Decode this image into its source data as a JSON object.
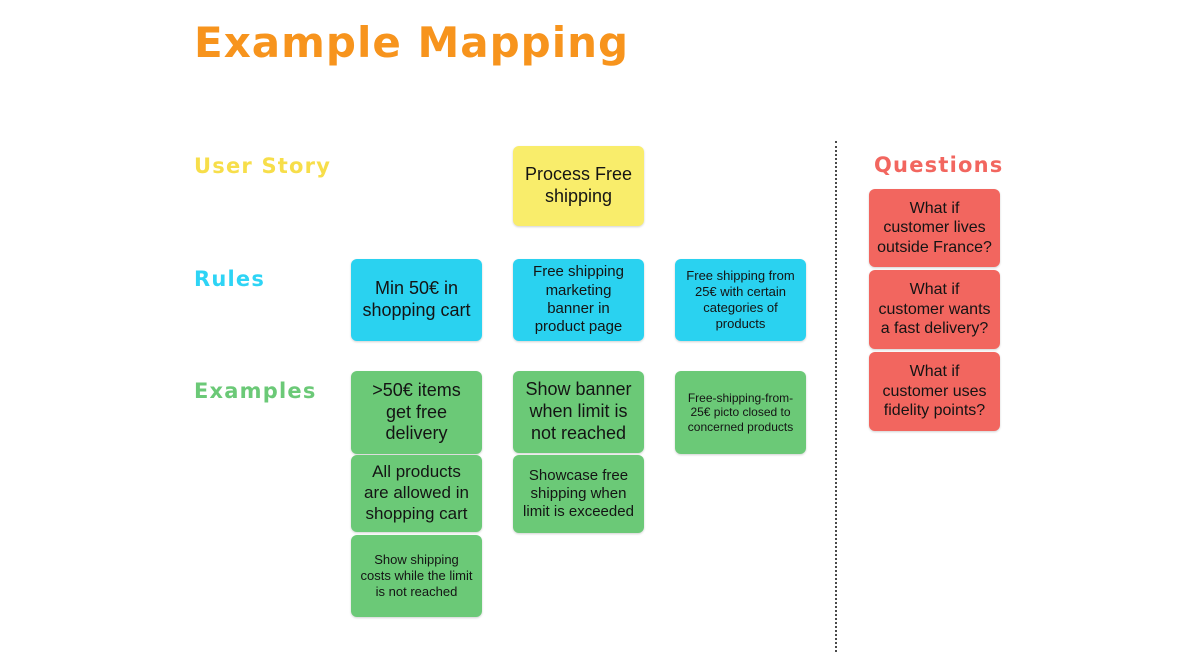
{
  "board": {
    "title": "Example Mapping",
    "divider_name": "vertical-dotted-divider"
  },
  "colors": {
    "title": "#F7941D",
    "user_story": "#F7DE4A",
    "rules": "#2ED4F5",
    "examples": "#6BC977",
    "questions": "#F2665F",
    "card_yellow": "#F9ED6B",
    "card_cyan": "#2AD2F0",
    "card_green": "#6BC977",
    "card_red": "#F2665F",
    "background": "#FFFFFF"
  },
  "rows": {
    "user_story": {
      "label": "User Story"
    },
    "rules": {
      "label": "Rules"
    },
    "examples": {
      "label": "Examples"
    }
  },
  "questions_section": {
    "label": "Questions"
  },
  "user_story_cards": [
    {
      "text": "Process Free shipping",
      "color": "yellow"
    }
  ],
  "rule_cards": [
    {
      "text": "Min 50€ in shopping cart",
      "color": "cyan"
    },
    {
      "text": "Free shipping marketing banner in product page",
      "color": "cyan"
    },
    {
      "text": "Free shipping from 25€ with certain categories of products",
      "color": "cyan"
    }
  ],
  "example_cards": {
    "column_1": [
      {
        "text": ">50€ items get free delivery",
        "color": "green"
      },
      {
        "text": "All products are allowed in shopping cart",
        "color": "green"
      },
      {
        "text": "Show shipping costs while the limit is not reached",
        "color": "green"
      }
    ],
    "column_2": [
      {
        "text": "Show banner when limit is not reached",
        "color": "green"
      },
      {
        "text": "Showcase free shipping when limit is exceeded",
        "color": "green"
      }
    ],
    "column_3": [
      {
        "text": "Free-shipping-from-25€ picto closed to concerned products",
        "color": "green"
      }
    ]
  },
  "question_cards": [
    {
      "text": "What if customer lives outside France?",
      "color": "red"
    },
    {
      "text": "What if customer wants a fast delivery?",
      "color": "red"
    },
    {
      "text": "What if customer uses fidelity points?",
      "color": "red"
    }
  ]
}
